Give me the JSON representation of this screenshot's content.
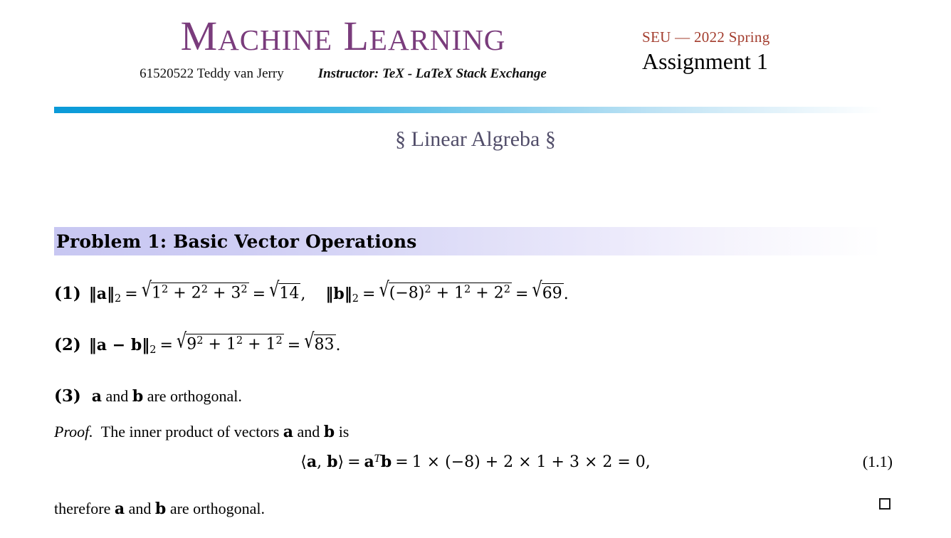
{
  "header": {
    "course_title": "Machine Learning",
    "student_id_name": "61520522 Teddy van Jerry",
    "instructor": "Instructor: TeX - LaTeX Stack Exchange",
    "term": "SEU — 2022 Spring",
    "assignment": "Assignment 1",
    "rule_color_start": "#0b9ad8",
    "rule_color_end": "#ffffff",
    "title_color": "#7a3c7c",
    "term_color": "#a33d2e"
  },
  "section": {
    "title": "§ Linear Algreba §",
    "color": "#514d69"
  },
  "problem": {
    "heading": "Problem 1: Basic Vector Operations",
    "band_color_start": "#c8c7f2",
    "band_color_end": "#ffffff"
  },
  "items": [
    {
      "number": "(1)",
      "parts": {
        "a_norm_label": "‖a‖",
        "a_norm_sub": "2",
        "a_radicand": "1² + 2² + 3²",
        "a_result_radicand": "14",
        "b_norm_label": "‖b‖",
        "b_norm_sub": "2",
        "b_radicand": "(−8)² + 1² + 2²",
        "b_result_radicand": "69",
        "trailing": "."
      },
      "plain_text": "‖a‖₂ = √(1² + 2² + 3²) = √14,   ‖b‖₂ = √((−8)² + 1² + 2²) = √69."
    },
    {
      "number": "(2)",
      "parts": {
        "norm_label": "‖a − b‖",
        "norm_sub": "2",
        "radicand": "9² + 1² + 1²",
        "result_radicand": "83",
        "trailing": "."
      },
      "plain_text": "‖a − b‖₂ = √(9² + 1² + 1²) = √83."
    },
    {
      "number": "(3)",
      "plain_text": "a and b are orthogonal.",
      "segments": {
        "vec_a": "a",
        "and": " and ",
        "vec_b": "b",
        "tail": " are orthogonal."
      }
    }
  ],
  "proof": {
    "keyword": "Proof.",
    "intro_pre": "The inner product of vectors ",
    "vec_a": "a",
    "intro_mid": " and ",
    "vec_b": "b",
    "intro_post": " is",
    "equation": "⟨a, b⟩ = aᵀb = 1 × (−8) + 2 × 1 + 3 × 2 = 0,",
    "equation_tag": "(1.1)",
    "conclusion_pre": "therefore ",
    "conclusion_mid": " and ",
    "conclusion_post": " are orthogonal.",
    "qed_symbol": "□"
  }
}
